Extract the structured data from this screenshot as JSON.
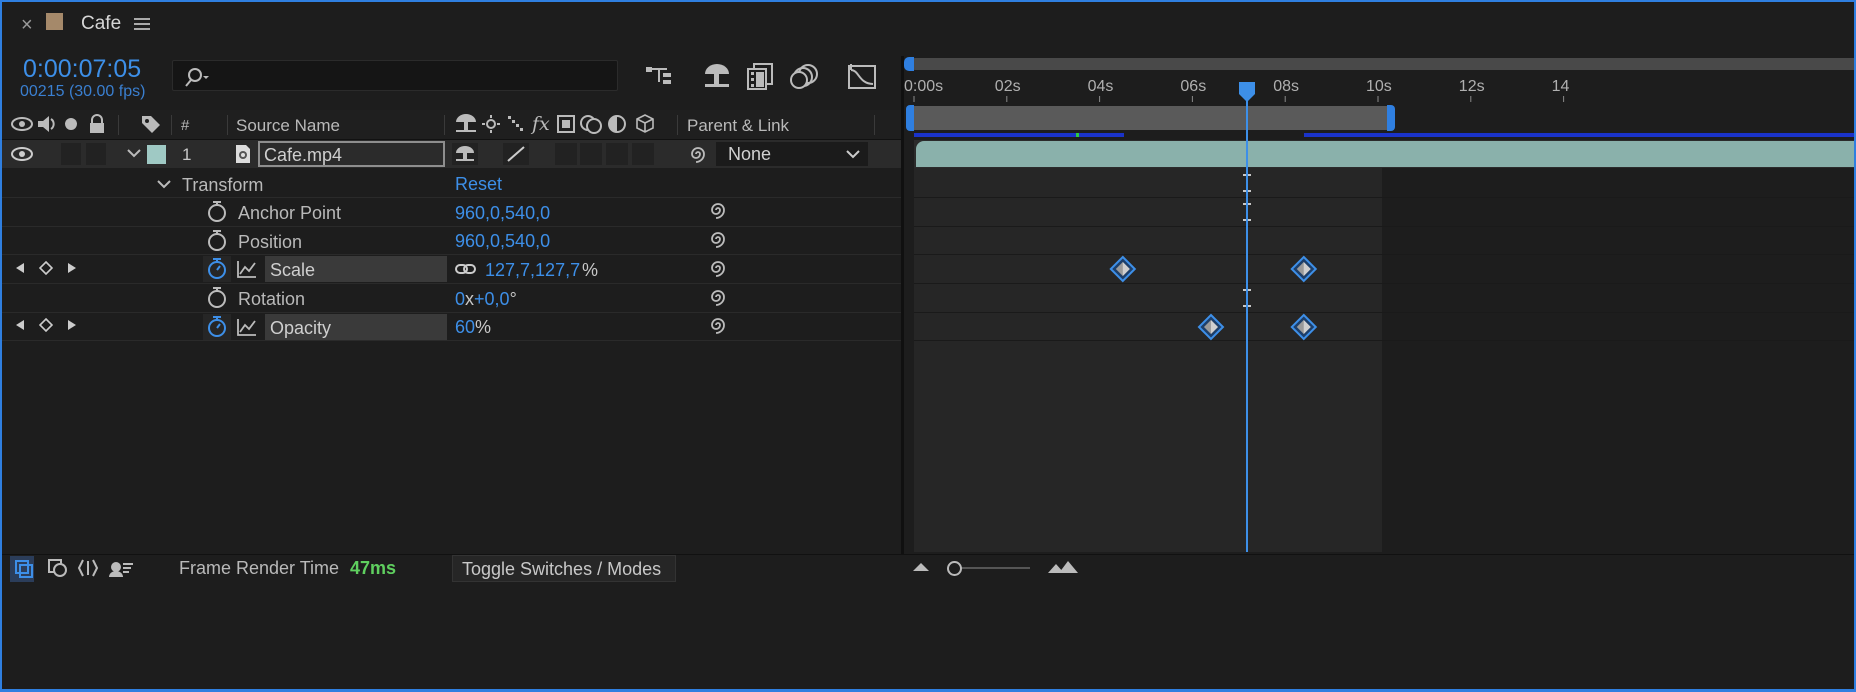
{
  "panel": {
    "title": "Cafe",
    "comp_color": "#a5896a",
    "close_icon": "close-icon",
    "menu_icon": "hamburger-menu-icon"
  },
  "time": {
    "current": "0:00:07:05",
    "frames": "00215 (30.00 fps)"
  },
  "search": {
    "placeholder": ""
  },
  "columns": {
    "number": "#",
    "source_name": "Source Name",
    "parent_link": "Parent & Link"
  },
  "layer": {
    "index": "1",
    "name": "Cafe.mp4",
    "label_color": "#9fc9c4",
    "parent": "None"
  },
  "transform": {
    "label": "Transform",
    "reset": "Reset",
    "properties": [
      {
        "name": "Anchor Point",
        "value": "960,0,540,0",
        "unit": ""
      },
      {
        "name": "Position",
        "value": "960,0,540,0",
        "unit": ""
      },
      {
        "name": "Scale",
        "value": "127,7,127,7",
        "unit": "%"
      },
      {
        "name": "Rotation",
        "value_a": "0",
        "value_sep": "x",
        "value_b": "+0,0",
        "unit": "°"
      },
      {
        "name": "Opacity",
        "value": "60",
        "unit": "%"
      }
    ]
  },
  "ruler": {
    "labels": [
      "0:00s",
      "02s",
      "04s",
      "06s",
      "08s",
      "10s",
      "12s",
      "14"
    ],
    "start_seconds": 0,
    "seconds_visible_max": 14,
    "playhead_seconds": 7.17,
    "work_area_end_seconds": 10.2
  },
  "keyframes": {
    "scale_seconds": [
      4.5,
      8.4
    ],
    "opacity_seconds": [
      6.4,
      8.4
    ]
  },
  "footer": {
    "render_label": "Frame Render Time",
    "render_value": "47ms",
    "toggle_label": "Toggle Switches / Modes"
  },
  "colors": {
    "accent": "#3d8fe8",
    "render_value": "#5fcf5f",
    "clip": "#8fb8b2"
  }
}
